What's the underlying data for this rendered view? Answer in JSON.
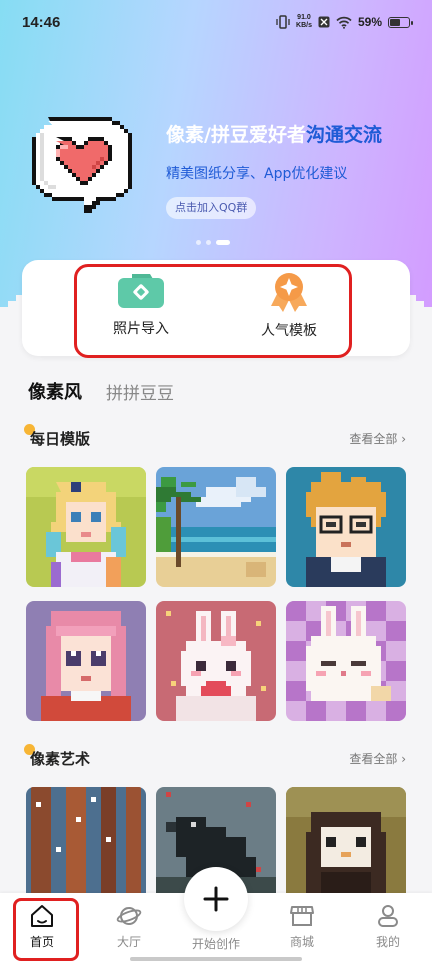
{
  "status_bar": {
    "time": "14:46",
    "net_speed_value": "91.0",
    "net_speed_unit": "KB/s",
    "battery": "59%",
    "battery_level": 0.59,
    "icons": [
      "vibrate-icon",
      "data-saver-icon",
      "wifi-icon",
      "battery-icon"
    ]
  },
  "banner": {
    "title_part1": "像素/拼豆爱好者",
    "title_part2": "沟通交流",
    "subtitle": "精美图纸分享、App优化建议",
    "join_button": "点击加入QQ群",
    "slide_count": 3,
    "active_slide": 3,
    "colors": {
      "title_highlight": "#1f5bd6",
      "heart": "#f06a6a"
    }
  },
  "quick_actions": [
    {
      "label": "照片导入",
      "icon": "camera-icon",
      "color": "#5ec9a8"
    },
    {
      "label": "人气模板",
      "icon": "badge-star-icon",
      "color": "#f59a48"
    }
  ],
  "tabs": [
    {
      "label": "像素风",
      "active": true
    },
    {
      "label": "拼拼豆豆",
      "active": false
    }
  ],
  "sections": [
    {
      "title": "每日模版",
      "see_all": "查看全部",
      "tiles": [
        "anime-girl-blue-hair",
        "beach-palm-tree",
        "boy-with-glasses",
        "pink-hair-girl",
        "white-bunny-heart",
        "bunny-checker-bg"
      ]
    },
    {
      "title": "像素艺术",
      "see_all": "查看全部",
      "tiles": [
        "forest-trees",
        "raven",
        "owl-portrait"
      ]
    }
  ],
  "bottom_nav": {
    "items": [
      {
        "label": "首页",
        "icon": "home-icon",
        "active": true
      },
      {
        "label": "大厅",
        "icon": "planet-icon",
        "active": false
      },
      {
        "label": "开始创作",
        "icon": "plus-icon",
        "active": false
      },
      {
        "label": "商城",
        "icon": "shop-icon",
        "active": false
      },
      {
        "label": "我的",
        "icon": "profile-icon",
        "active": false
      }
    ]
  }
}
